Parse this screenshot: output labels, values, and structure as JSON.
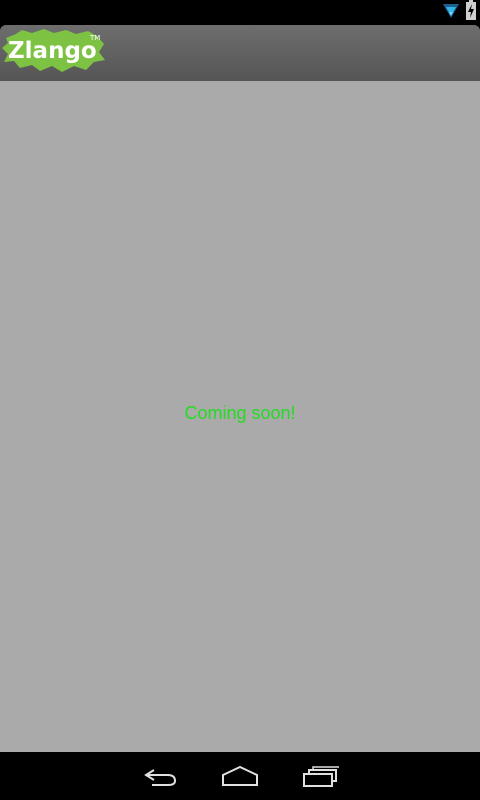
{
  "status_bar": {
    "icons": [
      "wifi-icon",
      "battery-charging-icon"
    ],
    "accent_color": "#33b5e5"
  },
  "header": {
    "logo_text": "Zlango",
    "logo_tm": "TM",
    "logo_color": "#7dc243"
  },
  "content": {
    "message": "Coming soon!",
    "message_color": "#22dd22",
    "background": "#aaaaaa"
  },
  "nav_bar": {
    "buttons": [
      "back-icon",
      "home-icon",
      "recent-apps-icon"
    ]
  }
}
